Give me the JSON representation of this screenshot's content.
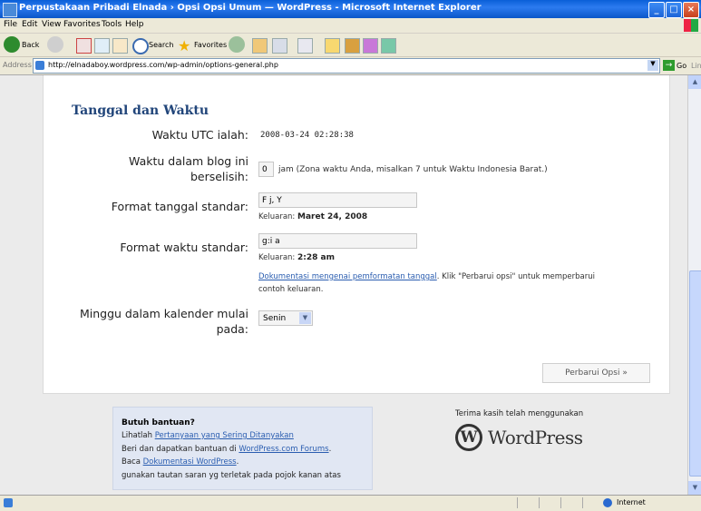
{
  "window": {
    "title": "Perpustakaan Pribadi Elnada › Opsi Opsi Umum — WordPress - Microsoft Internet Explorer"
  },
  "menu": [
    "File",
    "Edit",
    "View",
    "Favorites",
    "Tools",
    "Help"
  ],
  "toolbar": {
    "back_label": "Back",
    "search_label": "Search",
    "favorites_label": "Favorites"
  },
  "address": {
    "label": "Address",
    "url": "http://elnadaboy.wordpress.com/wp-admin/options-general.php",
    "go_label": "Go",
    "links_label": "Links"
  },
  "section": {
    "title": "Tanggal dan Waktu"
  },
  "utc": {
    "label": "Waktu UTC ialah:",
    "value": "2008-03-24 02:28:38"
  },
  "offset": {
    "label": "Waktu dalam blog ini berselisih:",
    "value": "0",
    "note": "jam (Zona waktu Anda, misalkan 7 untuk Waktu Indonesia Barat.)"
  },
  "date_format": {
    "label": "Format tanggal standar:",
    "value": "F j, Y",
    "output_label": "Keluaran:",
    "output_value": "Maret 24, 2008"
  },
  "time_format": {
    "label": "Format waktu standar:",
    "value": "g:i a",
    "output_label": "Keluaran:",
    "output_value": "2:28 am"
  },
  "doc_note": {
    "link": "Dokumentasi mengenai pemformatan tanggal",
    "text1": ". Klik \"Perbarui opsi\" untuk memperbarui",
    "text2": "contoh keluaran."
  },
  "week_start": {
    "label": "Minggu dalam kalender mulai pada:",
    "selected": "Senin"
  },
  "submit": {
    "label": "Perbarui Opsi »"
  },
  "help": {
    "title": "Butuh bantuan?",
    "line1_pre": "Lihatlah ",
    "line1_link": "Pertanyaan yang Sering Ditanyakan",
    "line2_pre": "Beri dan dapatkan bantuan di ",
    "line2_link": "WordPress.com Forums",
    "line2_post": ".",
    "line3_pre": "Baca ",
    "line3_link": "Dokumentasi WordPress",
    "line3_post": ".",
    "line4": "gunakan tautan saran yg terletak pada pojok kanan atas"
  },
  "footer": {
    "thanks": "Terima kasih telah menggunakan",
    "logo_text": "WordPress"
  },
  "status": {
    "zone": "Internet"
  }
}
